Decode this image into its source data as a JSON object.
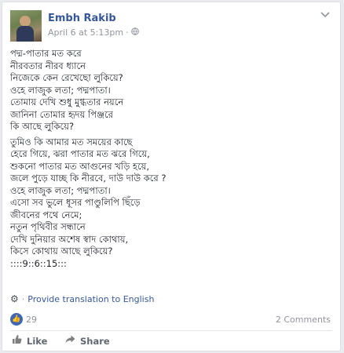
{
  "post": {
    "author": "Embh Rakib",
    "timestamp": "April 6 at 5:13pm",
    "privacy_icon": "globe-icon",
    "options_icon": "chevron-down-icon",
    "stanzas": [
      [
        "পদ্ম-পাতার মত করে",
        "নীরবতার নীরব ধ্যানে",
        "নিজেকে কেন রেখেছো লুকিয়ে?",
        "ওহে লাজুক লতা; পদ্মপাতা।",
        "তোমায় দেখি শুধু মুগ্ধতার নয়নে",
        "জানিনা তোমার হৃদয় পিঞ্জরে",
        "কি আছে লুকিয়ে?"
      ],
      [
        "তুমিও কি আমার মত সময়ের কাছে",
        "হেরে গিয়ে, ঝরা পাতার মত ঝরে গিয়ে,",
        "শুকনো পাতার মত আগুনের খড়ি হয়ে,",
        "জলে পুড়ে যাচ্ছ কি নীরবে, দাউ দাউ করে ?",
        "ওহে লাজুক লতা; পদ্মপাতা।",
        "এসো সব ভুলে ধূসর পাণ্ডুলিপি ছিঁড়ে",
        "জীবনের পথে নেমে;",
        "নতুন পৃথিবীর সন্ধানে",
        "দেখি দুনিয়ার অশেষ স্বাদ কোথায়,",
        "কিসে কোথায় আছে লুকিয়ে?",
        "::::9::6::15:::"
      ]
    ]
  },
  "translate": {
    "icon": "gear-icon",
    "label": "Provide translation to English"
  },
  "reactions": {
    "icon": "like-icon",
    "count": "29",
    "comments": "2 Comments"
  },
  "actions": {
    "like": "Like",
    "share": "Share"
  },
  "colors": {
    "link": "#365899",
    "muted": "#90949c",
    "like_blue": "#4267b2"
  }
}
